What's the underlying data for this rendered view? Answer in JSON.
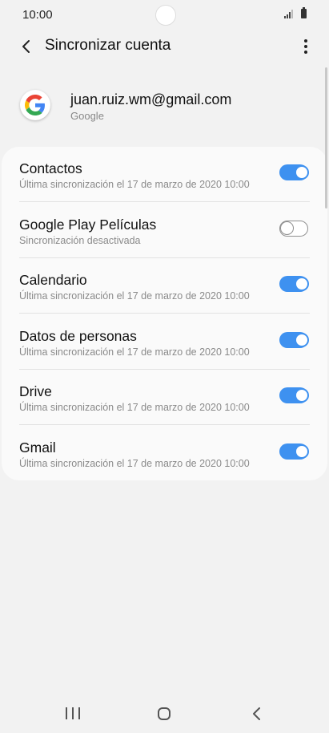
{
  "status_bar": {
    "time": "10:00"
  },
  "header": {
    "title": "Sincronizar cuenta"
  },
  "account": {
    "email": "juan.ruiz.wm@gmail.com",
    "type": "Google"
  },
  "sync_items": [
    {
      "label": "Contactos",
      "sub": "Última sincronización el 17 de marzo de 2020 10:00",
      "enabled": true
    },
    {
      "label": "Google Play Películas",
      "sub": "Sincronización desactivada",
      "enabled": false
    },
    {
      "label": "Calendario",
      "sub": "Última sincronización el 17 de marzo de 2020 10:00",
      "enabled": true
    },
    {
      "label": "Datos de personas",
      "sub": "Última sincronización el 17 de marzo de 2020 10:00",
      "enabled": true
    },
    {
      "label": "Drive",
      "sub": "Última sincronización el 17 de marzo de 2020 10:00",
      "enabled": true
    },
    {
      "label": "Gmail",
      "sub": "Última sincronización el 17 de marzo de 2020 10:00",
      "enabled": true
    }
  ],
  "colors": {
    "accent": "#3e91f0",
    "background": "#f2f2f2",
    "card": "#fafafa"
  },
  "icons": {
    "back": "chevron-left-icon",
    "more": "more-vertical-icon",
    "account": "google-logo-icon"
  }
}
